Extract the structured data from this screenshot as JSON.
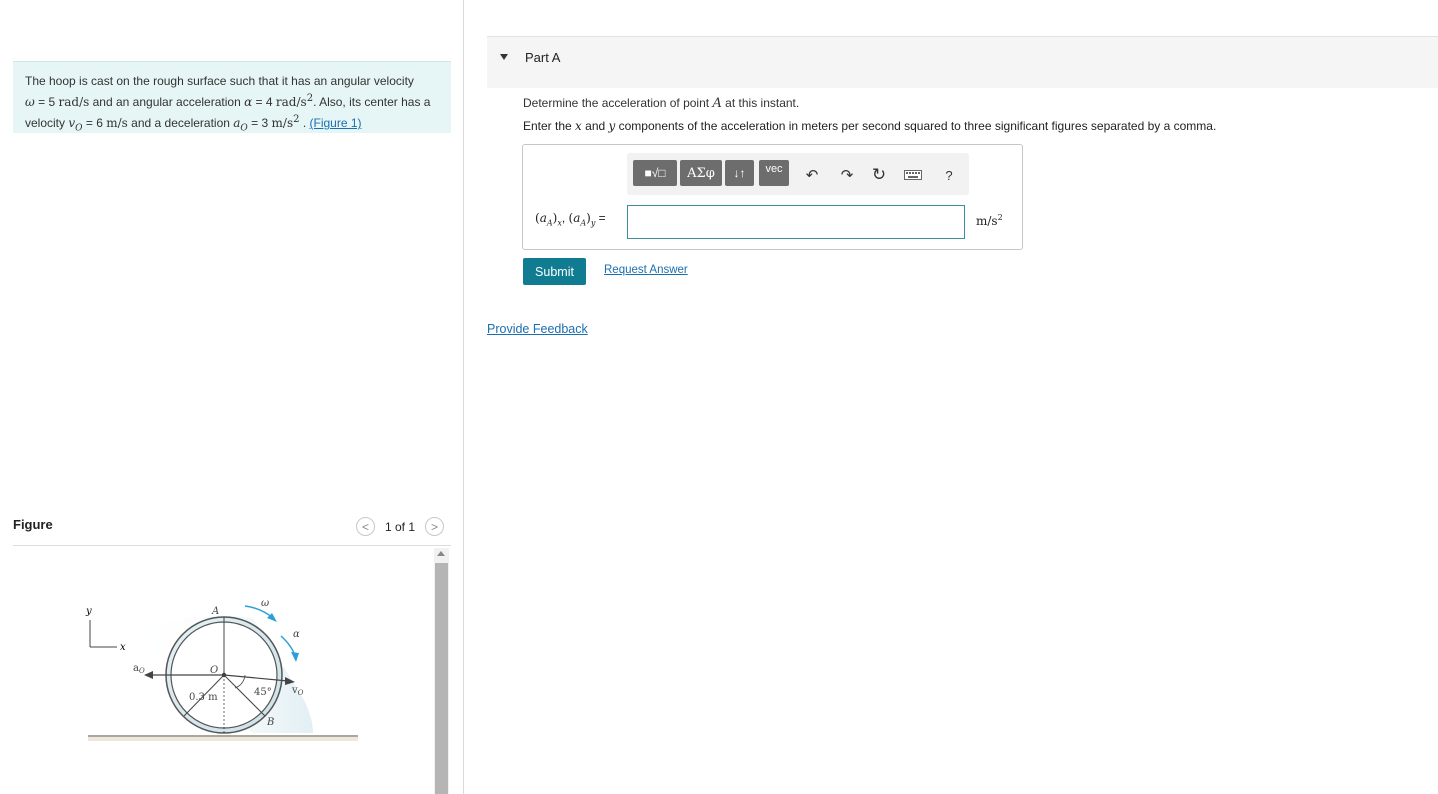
{
  "problem": {
    "line1": "The hoop is cast on the rough surface such that it has an angular velocity",
    "omega_sym": "ω",
    "eq": " = ",
    "omega_val": "5",
    "omega_unit": "rad/s",
    "and_alpha": " and an angular acceleration ",
    "alpha_sym": "α",
    "alpha_val": "4",
    "alpha_unit": "rad/s",
    "also": ". Also, its center has a",
    "velocity_text": "velocity ",
    "vo_sym": "v",
    "o_sub": "O",
    "vo_val": "6",
    "vo_unit": "m/s",
    "and_decel": " and a deceleration ",
    "ao_sym": "a",
    "ao_val": "3",
    "ao_unit": "m/s",
    "sep": " . ",
    "fig_link": "(Figure 1)"
  },
  "figure_panel": {
    "label": "Figure",
    "pager": "1 of 1",
    "prev": "<",
    "next": ">",
    "labels": {
      "y": "y",
      "x": "x",
      "A": "A",
      "omega": "ω",
      "alpha": "α",
      "ao": "a",
      "O": "O",
      "angle": "45°",
      "vo": "v",
      "radius": "0.3 m",
      "B": "B",
      "sub_O": "O"
    }
  },
  "part": {
    "title": "Part A",
    "q1_pre": "Determine the acceleration of point ",
    "q1_var": "A",
    "q1_post": " at this instant.",
    "q2_pre": "Enter the ",
    "q2_x": "x",
    "q2_and": " and ",
    "q2_y": "y",
    "q2_post": " components of the acceleration in meters per second squared to three significant figures separated by a comma."
  },
  "toolbar": {
    "templates": "■√□",
    "greek": "ΑΣφ",
    "arrows": "↓↑",
    "vec": "vec",
    "undo": "↶",
    "redo": "↷",
    "reset": "↻",
    "help": "?"
  },
  "answer": {
    "a": "a",
    "A": "A",
    "x": "x",
    "y": "y",
    "comma": ", ",
    "eq": " =",
    "value": "",
    "unit": "m/s",
    "unit_exp": "2"
  },
  "actions": {
    "submit": "Submit",
    "request": "Request Answer",
    "feedback": "Provide Feedback"
  },
  "colors": {
    "problem_bg": "#e6f5f5",
    "accent": "#0f7c91",
    "link": "#1a6fb0",
    "hoop_arrow": "#2d9fd8"
  }
}
